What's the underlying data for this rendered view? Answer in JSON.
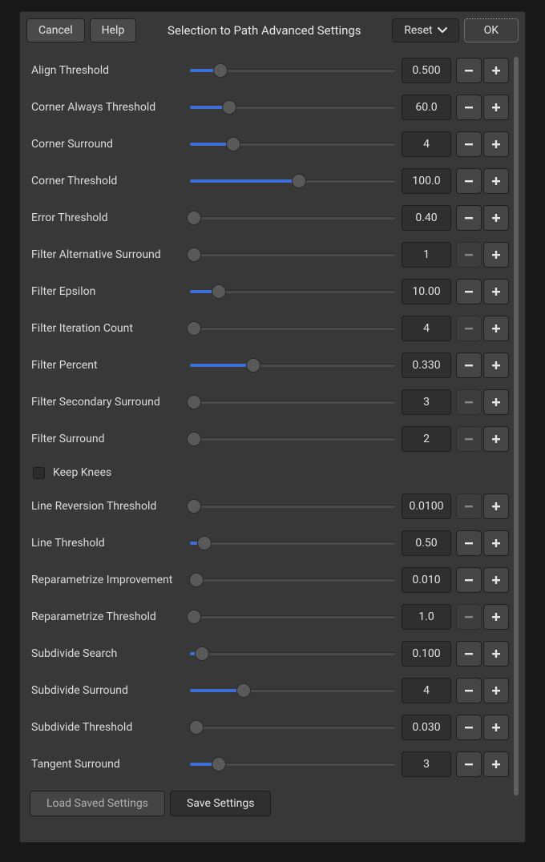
{
  "header": {
    "cancel": "Cancel",
    "help": "Help",
    "title": "Selection to Path Advanced Settings",
    "reset": "Reset",
    "ok": "OK"
  },
  "params": [
    {
      "label": "Align Threshold",
      "value": "0.500",
      "pos": 15,
      "minusDisabled": false
    },
    {
      "label": "Corner Always Threshold",
      "value": "60.0",
      "pos": 19,
      "minusDisabled": false
    },
    {
      "label": "Corner Surround",
      "value": "4",
      "pos": 21,
      "minusDisabled": false
    },
    {
      "label": "Corner Threshold",
      "value": "100.0",
      "pos": 53,
      "minusDisabled": false
    },
    {
      "label": "Error Threshold",
      "value": "0.40",
      "pos": 2,
      "minusDisabled": false
    },
    {
      "label": "Filter Alternative Surround",
      "value": "1",
      "pos": 2,
      "minusDisabled": true
    },
    {
      "label": "Filter Epsilon",
      "value": "10.00",
      "pos": 14,
      "minusDisabled": false
    },
    {
      "label": "Filter Iteration Count",
      "value": "4",
      "pos": 2,
      "minusDisabled": true
    },
    {
      "label": "Filter Percent",
      "value": "0.330",
      "pos": 31,
      "minusDisabled": false
    },
    {
      "label": "Filter Secondary Surround",
      "value": "3",
      "pos": 2,
      "minusDisabled": true
    },
    {
      "label": "Filter Surround",
      "value": "2",
      "pos": 2,
      "minusDisabled": true
    }
  ],
  "checkbox": {
    "label": "Keep Knees",
    "checked": false
  },
  "params2": [
    {
      "label": "Line Reversion Threshold",
      "value": "0.0100",
      "pos": 2,
      "minusDisabled": true
    },
    {
      "label": "Line Threshold",
      "value": "0.50",
      "pos": 7,
      "minusDisabled": false
    },
    {
      "label": "Reparametrize Improvement",
      "value": "0.010",
      "pos": 3,
      "minusDisabled": false
    },
    {
      "label": "Reparametrize Threshold",
      "value": "1.0",
      "pos": 2,
      "minusDisabled": true
    },
    {
      "label": "Subdivide Search",
      "value": "0.100",
      "pos": 6,
      "minusDisabled": false
    },
    {
      "label": "Subdivide Surround",
      "value": "4",
      "pos": 26,
      "minusDisabled": false
    },
    {
      "label": "Subdivide Threshold",
      "value": "0.030",
      "pos": 3,
      "minusDisabled": false
    },
    {
      "label": "Tangent Surround",
      "value": "3",
      "pos": 14,
      "minusDisabled": false
    }
  ],
  "footer": {
    "load": "Load Saved Settings",
    "save": "Save Settings"
  }
}
